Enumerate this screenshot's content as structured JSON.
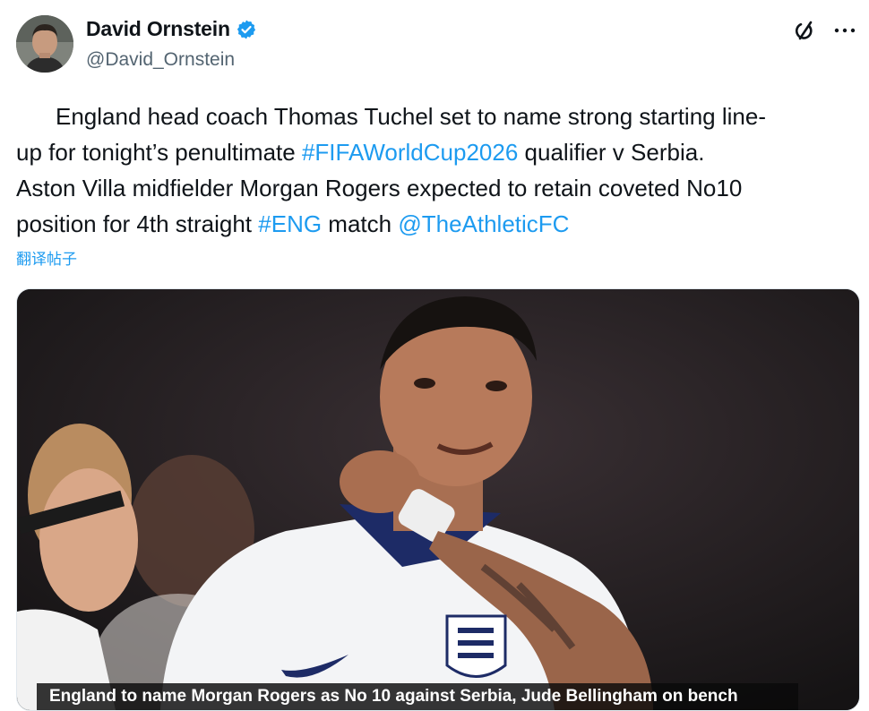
{
  "author": {
    "display_name": "David Ornstein",
    "handle": "@David_Ornstein",
    "verified": true
  },
  "tweet": {
    "line1": "England head coach Thomas Tuchel set to name strong starting line-",
    "line2_pre": "up for tonight’s penultimate ",
    "hashtag_fifa": "#FIFAWorldCup2026",
    "line2_post": " qualifier v Serbia.",
    "line3": "Aston Villa midfielder Morgan Rogers expected to retain coveted No10",
    "line4_pre": "position for 4th straight ",
    "hashtag_eng": "#ENG",
    "line4_mid": " match ",
    "mention": "@TheAthleticFC"
  },
  "translate_label": "翻译帖子",
  "media": {
    "caption": "England to name Morgan Rogers as No 10 against Serbia, Jude Bellingham on bench"
  },
  "colors": {
    "link": "#1d9bf0",
    "verified_badge": "#1d9bf0",
    "text_primary": "#0f1419",
    "text_secondary": "#536471"
  },
  "icons": [
    "grok-icon",
    "more-icon",
    "verified-icon"
  ]
}
